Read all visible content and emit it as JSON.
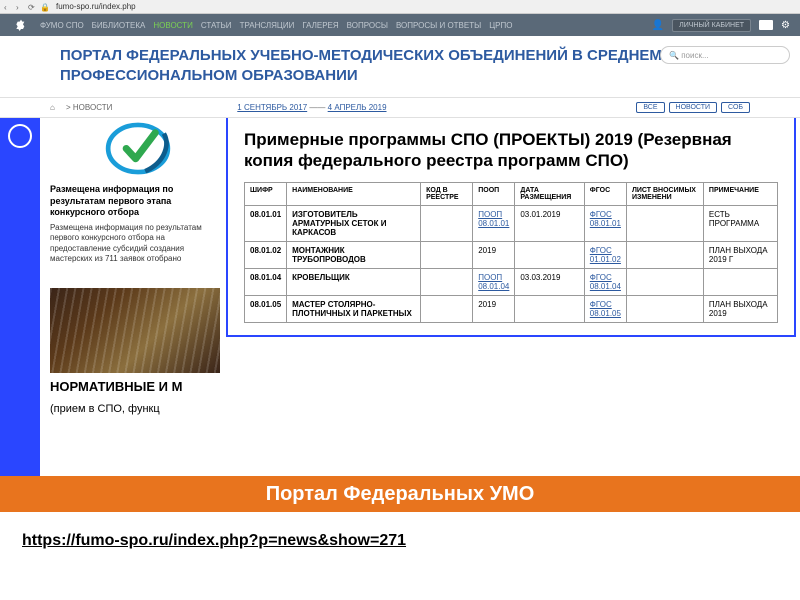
{
  "browser": {
    "url": "fumo-spo.ru/index.php"
  },
  "topnav": {
    "items": [
      {
        "label": "ФУМО СПО"
      },
      {
        "label": "БИБЛИОТЕКА"
      },
      {
        "label": "НОВОСТИ",
        "active": true
      },
      {
        "label": "СТАТЬИ"
      },
      {
        "label": "ТРАНСЛЯЦИИ"
      },
      {
        "label": "ГАЛЕРЕЯ"
      },
      {
        "label": "ВОПРОСЫ"
      },
      {
        "label": "ВОПРОСЫ И ОТВЕТЫ"
      },
      {
        "label": "ЦРПО"
      }
    ],
    "cabinet": "ЛИЧНЫЙ КАБИНЕТ"
  },
  "header": {
    "title": "ПОРТАЛ ФЕДЕРАЛЬНЫХ УЧЕБНО-МЕТОДИЧЕСКИХ ОБЪЕДИНЕНИЙ В СРЕДНЕМ ПРОФЕССИОНАЛЬНОМ ОБРАЗОВАНИИ",
    "search_placeholder": "поиск..."
  },
  "breadcrumb": {
    "section": "НОВОСТИ",
    "arrow": ">"
  },
  "date_range": {
    "from": "1 СЕНТЯБРЬ 2017",
    "to": "4 АПРЕЛЬ 2019",
    "sep": "——"
  },
  "filter_tabs": [
    "ВСЕ",
    "НОВОСТИ",
    "СОБ"
  ],
  "card1": {
    "title": "Размещена информация по результатам первого этапа конкурсного отбора",
    "text": "Размещена информация по результатам первого конкурсного отбора на предоставление субсидий создания мастерских из 711 заявок отобрано"
  },
  "card2": {
    "title": "НОРМАТИВНЫЕ И М",
    "sub": "(прием в СПО, функц"
  },
  "overlay": {
    "title": "Примерные программы СПО (ПРОЕКТЫ) 2019 (Резервная копия федерального реестра программ СПО)",
    "headers": [
      "ШИФР",
      "НАИМЕНОВАНИЕ",
      "КОД В РЕЕСТРЕ",
      "ПООП",
      "ДАТА РАЗМЕЩЕНИЯ",
      "ФГОС",
      "ЛИСТ ВНОСИМЫХ ИЗМЕНЕНИ",
      "ПРИМЕЧАНИЕ"
    ],
    "rows": [
      {
        "code": "08.01.01",
        "name": "ИЗГОТОВИТЕЛЬ АРМАТУРНЫХ СЕТОК И КАРКАСОВ",
        "reg": "",
        "poop": "ПООП 08.01.01",
        "date": "03.01.2019",
        "fgos": "ФГОС 08.01.01",
        "list": "",
        "note": "ЕСТЬ ПРОГРАММА"
      },
      {
        "code": "08.01.02",
        "name": "МОНТАЖНИК ТРУБОПРОВОДОВ",
        "reg": "",
        "poop": "2019",
        "date": "",
        "fgos": "ФГОС 01.01.02",
        "list": "",
        "note": "ПЛАН ВЫХОДА 2019 Г"
      },
      {
        "code": "08.01.04",
        "name": "КРОВЕЛЬЩИК",
        "reg": "",
        "poop": "ПООП 08.01.04",
        "date": "03.03.2019",
        "fgos": "ФГОС 08.01.04",
        "list": "",
        "note": ""
      },
      {
        "code": "08.01.05",
        "name": "МАСТЕР СТОЛЯРНО-ПЛОТНИЧНЫХ И ПАРКЕТНЫХ",
        "reg": "",
        "poop": "2019",
        "date": "",
        "fgos": "ФГОС 08.01.05",
        "list": "",
        "note": "ПЛАН ВЫХОДА 2019"
      }
    ]
  },
  "banner": "Портал Федеральных УМО",
  "bottom_url": "https://fumo-spo.ru/index.php?p=news&show=271"
}
